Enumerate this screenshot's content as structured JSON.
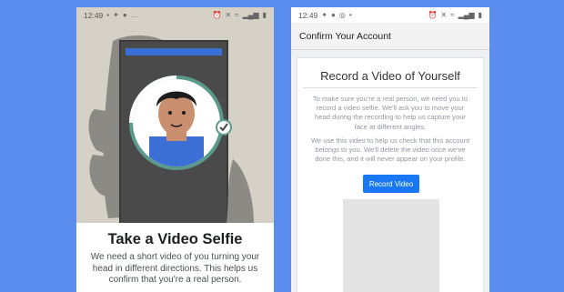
{
  "left_phone": {
    "status": {
      "time": "12:49",
      "left_icons": [
        "sim-icon",
        "twitter-icon",
        "messenger-icon",
        "more-icon"
      ],
      "right_icons": [
        "alarm-icon",
        "mute-icon",
        "wifi-icon",
        "signal-icon",
        "battery-icon"
      ]
    },
    "title": "Take a Video Selfie",
    "description": "We need a short video of you turning your head in different directions. This helps us confirm that you're a real person."
  },
  "right_phone": {
    "status": {
      "time": "12:49",
      "left_icons": [
        "sim-icon",
        "twitter-icon",
        "messenger-icon",
        "whatsapp-icon",
        "dot-icon"
      ],
      "right_icons": [
        "alarm-icon",
        "mute-icon",
        "wifi-icon",
        "signal-icon",
        "battery-icon"
      ]
    },
    "app_title": "Confirm Your Account",
    "heading": "Record a Video of Yourself",
    "paragraph1": "To make sure you're a real person, we need you to record a video selfie. We'll ask you to move your head during the recording to help us capture your face at different angles.",
    "paragraph2": "We use this video to help us check that this account belongs to you. We'll delete the video once we've done this, and it will never appear on your profile.",
    "record_button": "Record Video"
  },
  "colors": {
    "background": "#5b8def",
    "brand_blue": "#1877f2",
    "illustration_bg": "#d6d1c7",
    "phone_dark": "#4a4a4a",
    "shirt_blue": "#3b6fd6"
  }
}
